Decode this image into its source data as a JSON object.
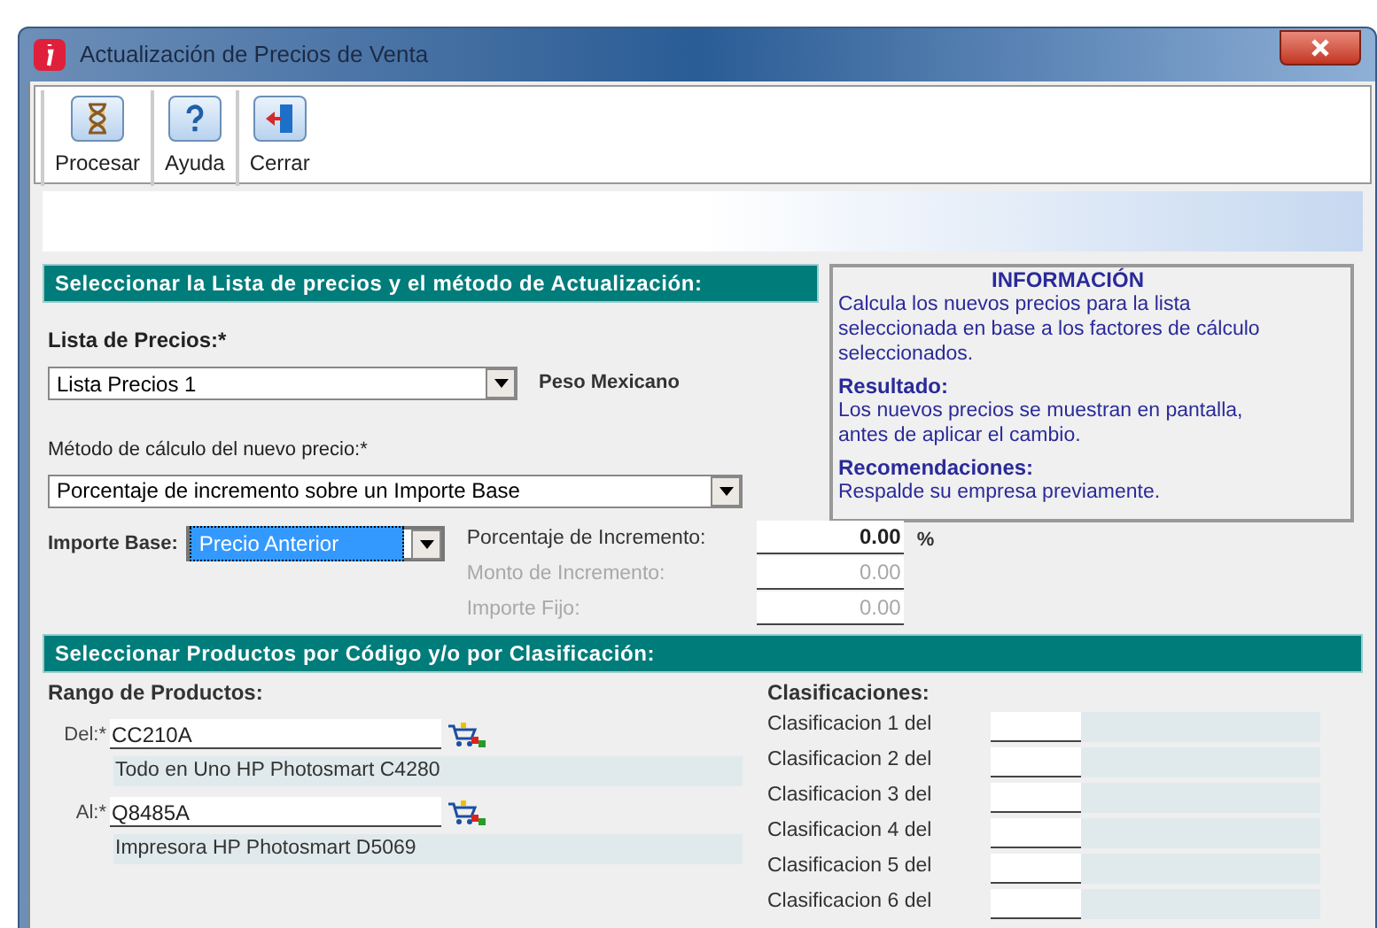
{
  "window": {
    "title": "Actualización de Precios de Venta"
  },
  "toolbar": [
    {
      "kind": "process",
      "label": "Procesar"
    },
    {
      "kind": "help",
      "label": "Ayuda"
    },
    {
      "kind": "close",
      "label": "Cerrar"
    }
  ],
  "list_section": {
    "header": "Seleccionar la Lista de precios y el método de Actualización:",
    "price_list": {
      "label": "Lista de Precios:*",
      "value": "Lista Precios 1",
      "currency": "Peso Mexicano"
    },
    "method": {
      "label": "Método de cálculo del nuevo precio:*",
      "value": "Porcentaje de incremento sobre un Importe Base"
    },
    "base": {
      "label": "Importe Base:",
      "value": "Precio Anterior",
      "selected": true
    },
    "amounts": [
      {
        "label": "Porcentaje de Incremento:",
        "value": "0.00",
        "unit": "%",
        "disabled": false
      },
      {
        "label": "Monto de Incremento:",
        "value": "0.00",
        "disabled": true
      },
      {
        "label": "Importe Fijo:",
        "value": "0.00",
        "disabled": true
      }
    ]
  },
  "info": {
    "title": "INFORMACIÓN",
    "blocks": [
      {
        "text": "Calcula los nuevos precios para la lista seleccionada en base a los factores de cálculo seleccionados."
      },
      {
        "heading": "Resultado:",
        "text": "Los nuevos precios se muestran en pantalla, antes de aplicar el cambio."
      },
      {
        "heading": "Recomendaciones:",
        "text": "Respalde su empresa previamente."
      }
    ]
  },
  "products_section": {
    "header": "Seleccionar Productos por Código y/o por Clasificación:",
    "range_title": "Rango de Productos:",
    "range": [
      {
        "label": "Del:*",
        "code": "CC210A",
        "description": "Todo en Uno HP Photosmart C4280"
      },
      {
        "label": "Al:*",
        "code": "Q8485A",
        "description": "Impresora HP Photosmart D5069"
      }
    ],
    "classifications_title": "Clasificaciones:",
    "classifications": [
      {
        "label": "Clasificacion 1 del"
      },
      {
        "label": "Clasificacion 2 del"
      },
      {
        "label": "Clasificacion 3 del"
      },
      {
        "label": "Clasificacion 4 del"
      },
      {
        "label": "Clasificacion 5 del"
      },
      {
        "label": "Clasificacion 6 del"
      }
    ]
  }
}
